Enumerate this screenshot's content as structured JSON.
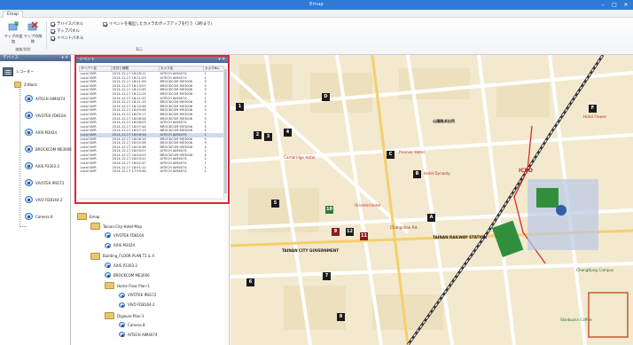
{
  "window": {
    "title": "Emap"
  },
  "tabs": {
    "active": "Emap"
  },
  "ribbon": {
    "btn_map_create": "マップの追加",
    "btn_map_delete": "マップの削除",
    "group_map_edit": "編集/削除",
    "chk_device_panel": "デバイスパネル",
    "chk_map_panel": "マップパネル",
    "chk_event_panel": "イベントパネル",
    "chk_popup": "イベントを検出したカメラのポップアップを行う（3秒まで）",
    "group_display": "表示"
  },
  "device_panel": {
    "header": "デバイス",
    "recorder_label": "レコーダー",
    "group_label": "Z-Block",
    "cameras": [
      "AITECH AIM4074",
      "VIVOTEK FD8164",
      "AXIS M3024",
      "BROCKCOM ME3006",
      "AXIS P3303-2",
      "VIVOTEK IP8172",
      "VIVO FD8164-2",
      "Camera 8"
    ]
  },
  "event_panel": {
    "header": "イベント",
    "columns": [
      "サーバー名",
      "日付と時間",
      "カメラ名",
      "カメラNo."
    ],
    "rows": [
      [
        "Local NVR",
        "2014-12-17 18:28:11",
        "AITECH AIM4074",
        "1"
      ],
      [
        "Local NVR",
        "2014-12-17 18:21:53",
        "AITECH AIM4074",
        "1"
      ],
      [
        "Local NVR",
        "2014-12-17 18:21:09",
        "BROCKCOM ME3006",
        "5"
      ],
      [
        "Local NVR",
        "2014-12-17 18:13:07",
        "BROCKCOM ME3006",
        "5"
      ],
      [
        "Local NVR",
        "2014-12-17 18:12:45",
        "BROCKCOM ME3006",
        "5"
      ],
      [
        "Local NVR",
        "2014-12-17 18:12:25",
        "BROCKCOM ME3006",
        "5"
      ],
      [
        "Local NVR",
        "2014-12-17 18:11:52",
        "AITECH AIM4074",
        "1"
      ],
      [
        "Local NVR",
        "2014-12-17 18:11:19",
        "BROCKCOM ME3006",
        "5"
      ],
      [
        "Local NVR",
        "2014-12-17 18:10:48",
        "BROCKCOM ME3006",
        "5"
      ],
      [
        "Local NVR",
        "2014-12-17 18:09:48",
        "BROCKCOM ME3006",
        "5"
      ],
      [
        "Local NVR",
        "2014-12-17 18:09:17",
        "BROCKCOM ME3006",
        "5"
      ],
      [
        "Local NVR",
        "2014-12-17 18:08:56",
        "BROCKCOM ME3006",
        "5"
      ],
      [
        "Local NVR",
        "2014-12-17 18:08:05",
        "AITECH AIM4074",
        "1"
      ],
      [
        "Local NVR",
        "2014-12-17 18:07:44",
        "BROCKCOM ME3006",
        "5"
      ],
      [
        "Local NVR",
        "2014-12-17 18:07:19",
        "BROCKCOM ME3006",
        "5"
      ],
      [
        "Local NVR",
        "2014-12-17 18:06:58",
        "AITECH AIM4074",
        "1"
      ],
      [
        "Local NVR",
        "2014-12-17 18:06:28",
        "BROCKCOM ME3006",
        "5"
      ],
      [
        "Local NVR",
        "2014-12-17 18:05:58",
        "BROCKCOM ME3006",
        "5"
      ],
      [
        "Local NVR",
        "2014-12-17 18:05:36",
        "BROCKCOM ME3006",
        "5"
      ],
      [
        "Local NVR",
        "2014-12-17 18:05:07",
        "AITECH AIM4074",
        "1"
      ],
      [
        "Local NVR",
        "2014-12-17 18:04:29",
        "BROCKCOM ME3006",
        "5"
      ],
      [
        "Local NVR",
        "2014-12-17 18:03:41",
        "AITECH AIM4074",
        "1"
      ],
      [
        "Local NVR",
        "2014-12-17 18:02:47",
        "AITECH AIM4074",
        "1"
      ],
      [
        "Local NVR",
        "2014-12-17 18:01:12",
        "AITECH AIM4074",
        "1"
      ],
      [
        "Local NVR",
        "2014-12-17 17:59:46",
        "AITECH AIM4074",
        "1"
      ]
    ]
  },
  "map_panel": {
    "header": "マップ",
    "items": [
      {
        "label": "Emap",
        "kind": "folder"
      },
      {
        "label": "Tainan-City-Hotel-Map",
        "kind": "folder"
      },
      {
        "label": "VIVOTEK FD8164",
        "kind": "camera"
      },
      {
        "label": "AXIS M3024",
        "kind": "camera"
      },
      {
        "label": "Building_FLOOR PLAN T1 & 4",
        "kind": "folder"
      },
      {
        "label": "AXIS P3303-2",
        "kind": "camera"
      },
      {
        "label": "BROCKCOM ME3006",
        "kind": "camera"
      },
      {
        "label": "Home Floor Plan-1",
        "kind": "folder"
      },
      {
        "label": "VIVOTEK IP8172",
        "kind": "camera"
      },
      {
        "label": "VIVO FD8164-2",
        "kind": "camera"
      },
      {
        "label": "Digiever-Plan-1",
        "kind": "folder"
      },
      {
        "label": "Camera 8",
        "kind": "camera"
      },
      {
        "label": "AITECH AIM4074",
        "kind": "camera"
      }
    ]
  },
  "map": {
    "labels": {
      "ichpd": "ICPD",
      "tainan_station": "TAINAN RAILWAY STATION",
      "tainan_city": "TAINAN CITY GOVERNMENT",
      "chengkung": "ChengKung Campus",
      "chongshan": "Chongshan Rd.",
      "cambridge": "Cambridge Hotel",
      "premier": "Premier Hotel",
      "dynasty": "Hotel Dynasty",
      "oriental": "Oriental Hotel",
      "flower": "Hotel Flower",
      "police": "公園路派出所",
      "starbucks": "Starbucks Coffee"
    },
    "markers": [
      "D",
      "C",
      "B",
      "A",
      "F",
      "1",
      "2",
      "3",
      "4",
      "5",
      "6",
      "7",
      "8",
      "9",
      "10",
      "11",
      "12"
    ]
  },
  "colors": {
    "title_bar": "#2f7ad6",
    "event_highlight": "#e0232e",
    "panel_header": "#4e6690",
    "map_bg": "#f1e6c9"
  }
}
